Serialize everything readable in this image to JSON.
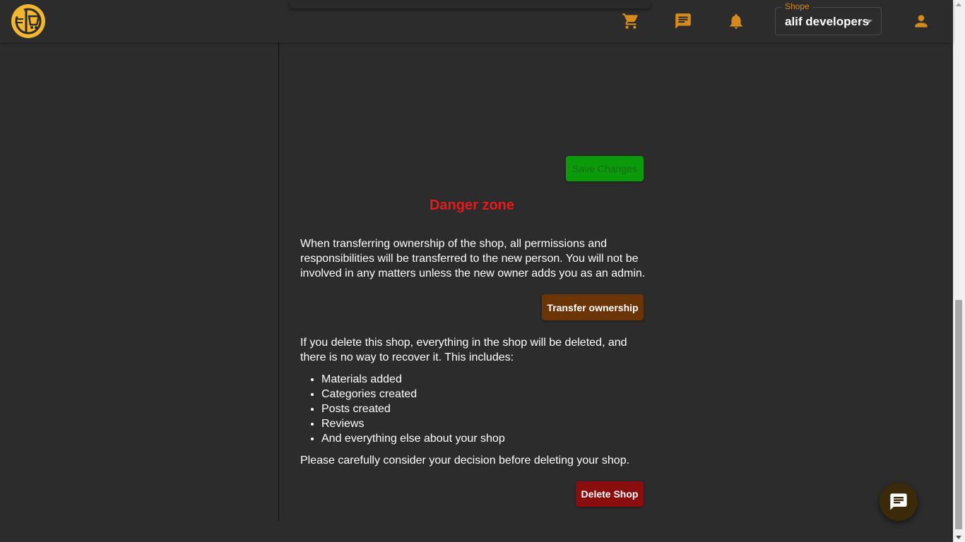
{
  "header": {
    "shop_label": "Shope",
    "shop_value": "alif developers",
    "icons": [
      "logo-icon",
      "cart-icon",
      "chat-icon",
      "bell-icon",
      "user-icon"
    ]
  },
  "colors": {
    "accent": "#d58a1d",
    "danger": "#e51b1b",
    "save": "#0a9a0a",
    "transfer": "#6b3507",
    "delete": "#8a0e0e",
    "background": "#2c2c2c"
  },
  "main": {
    "save_label": "Save Changes",
    "danger_title": "Danger zone",
    "transfer_text": "When transferring ownership of the shop, all permissions and responsibilities will be transferred to the new person. You will not be involved in any matters unless the new owner adds you as an admin.",
    "transfer_label": "Transfer ownership",
    "delete_text": "If you delete this shop, everything in the shop will be deleted, and there is no way to recover it. This includes:",
    "delete_items": [
      "Materials added",
      "Categories created",
      "Posts created",
      "Reviews",
      "And everything else about your shop"
    ],
    "consider_text": "Please carefully consider your decision before deleting your shop.",
    "delete_label": "Delete Shop"
  }
}
